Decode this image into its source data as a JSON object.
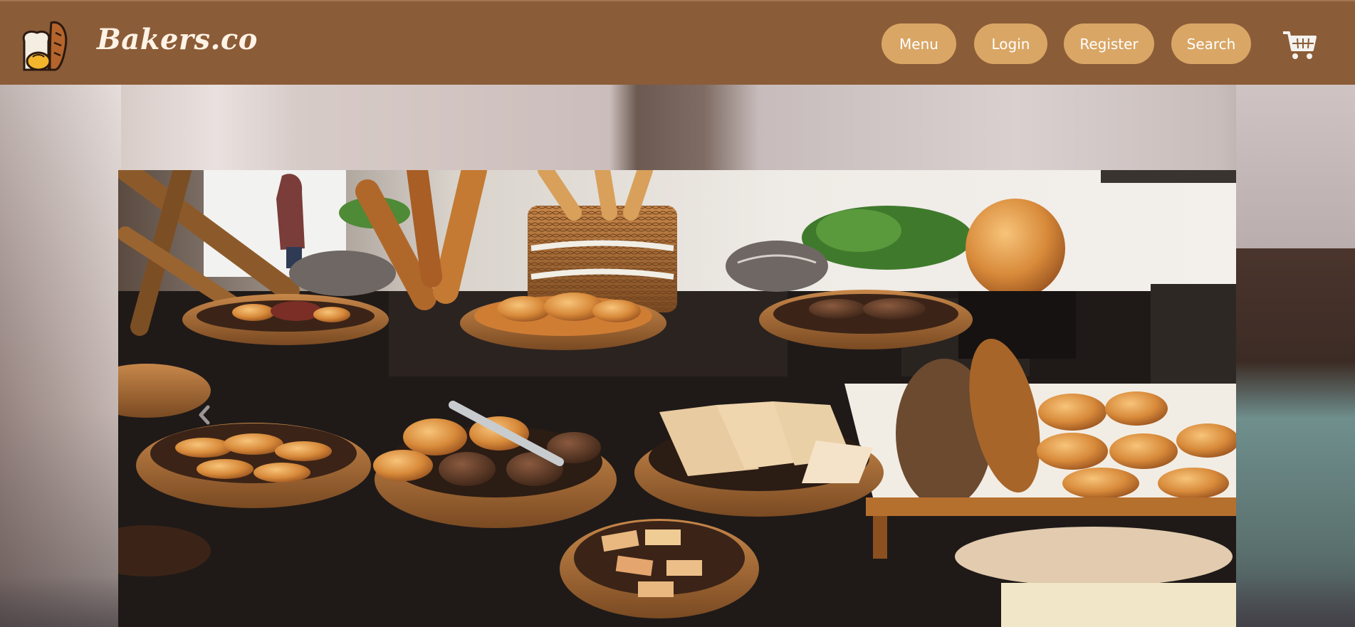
{
  "header": {
    "brand": "Bakers.co",
    "logo_icon": "bread-logo-icon",
    "nav": [
      {
        "label": "Menu"
      },
      {
        "label": "Login"
      },
      {
        "label": "Register"
      },
      {
        "label": "Search"
      }
    ],
    "cart_icon": "shopping-cart-icon"
  },
  "hero": {
    "image": "bakery-display-photo",
    "prev_icon": "chevron-left-icon"
  },
  "colors": {
    "navbar_bg": "#8b5c38",
    "button_bg": "#d9a665",
    "button_text": "#ffffff",
    "brand_text": "#fff3e6"
  }
}
